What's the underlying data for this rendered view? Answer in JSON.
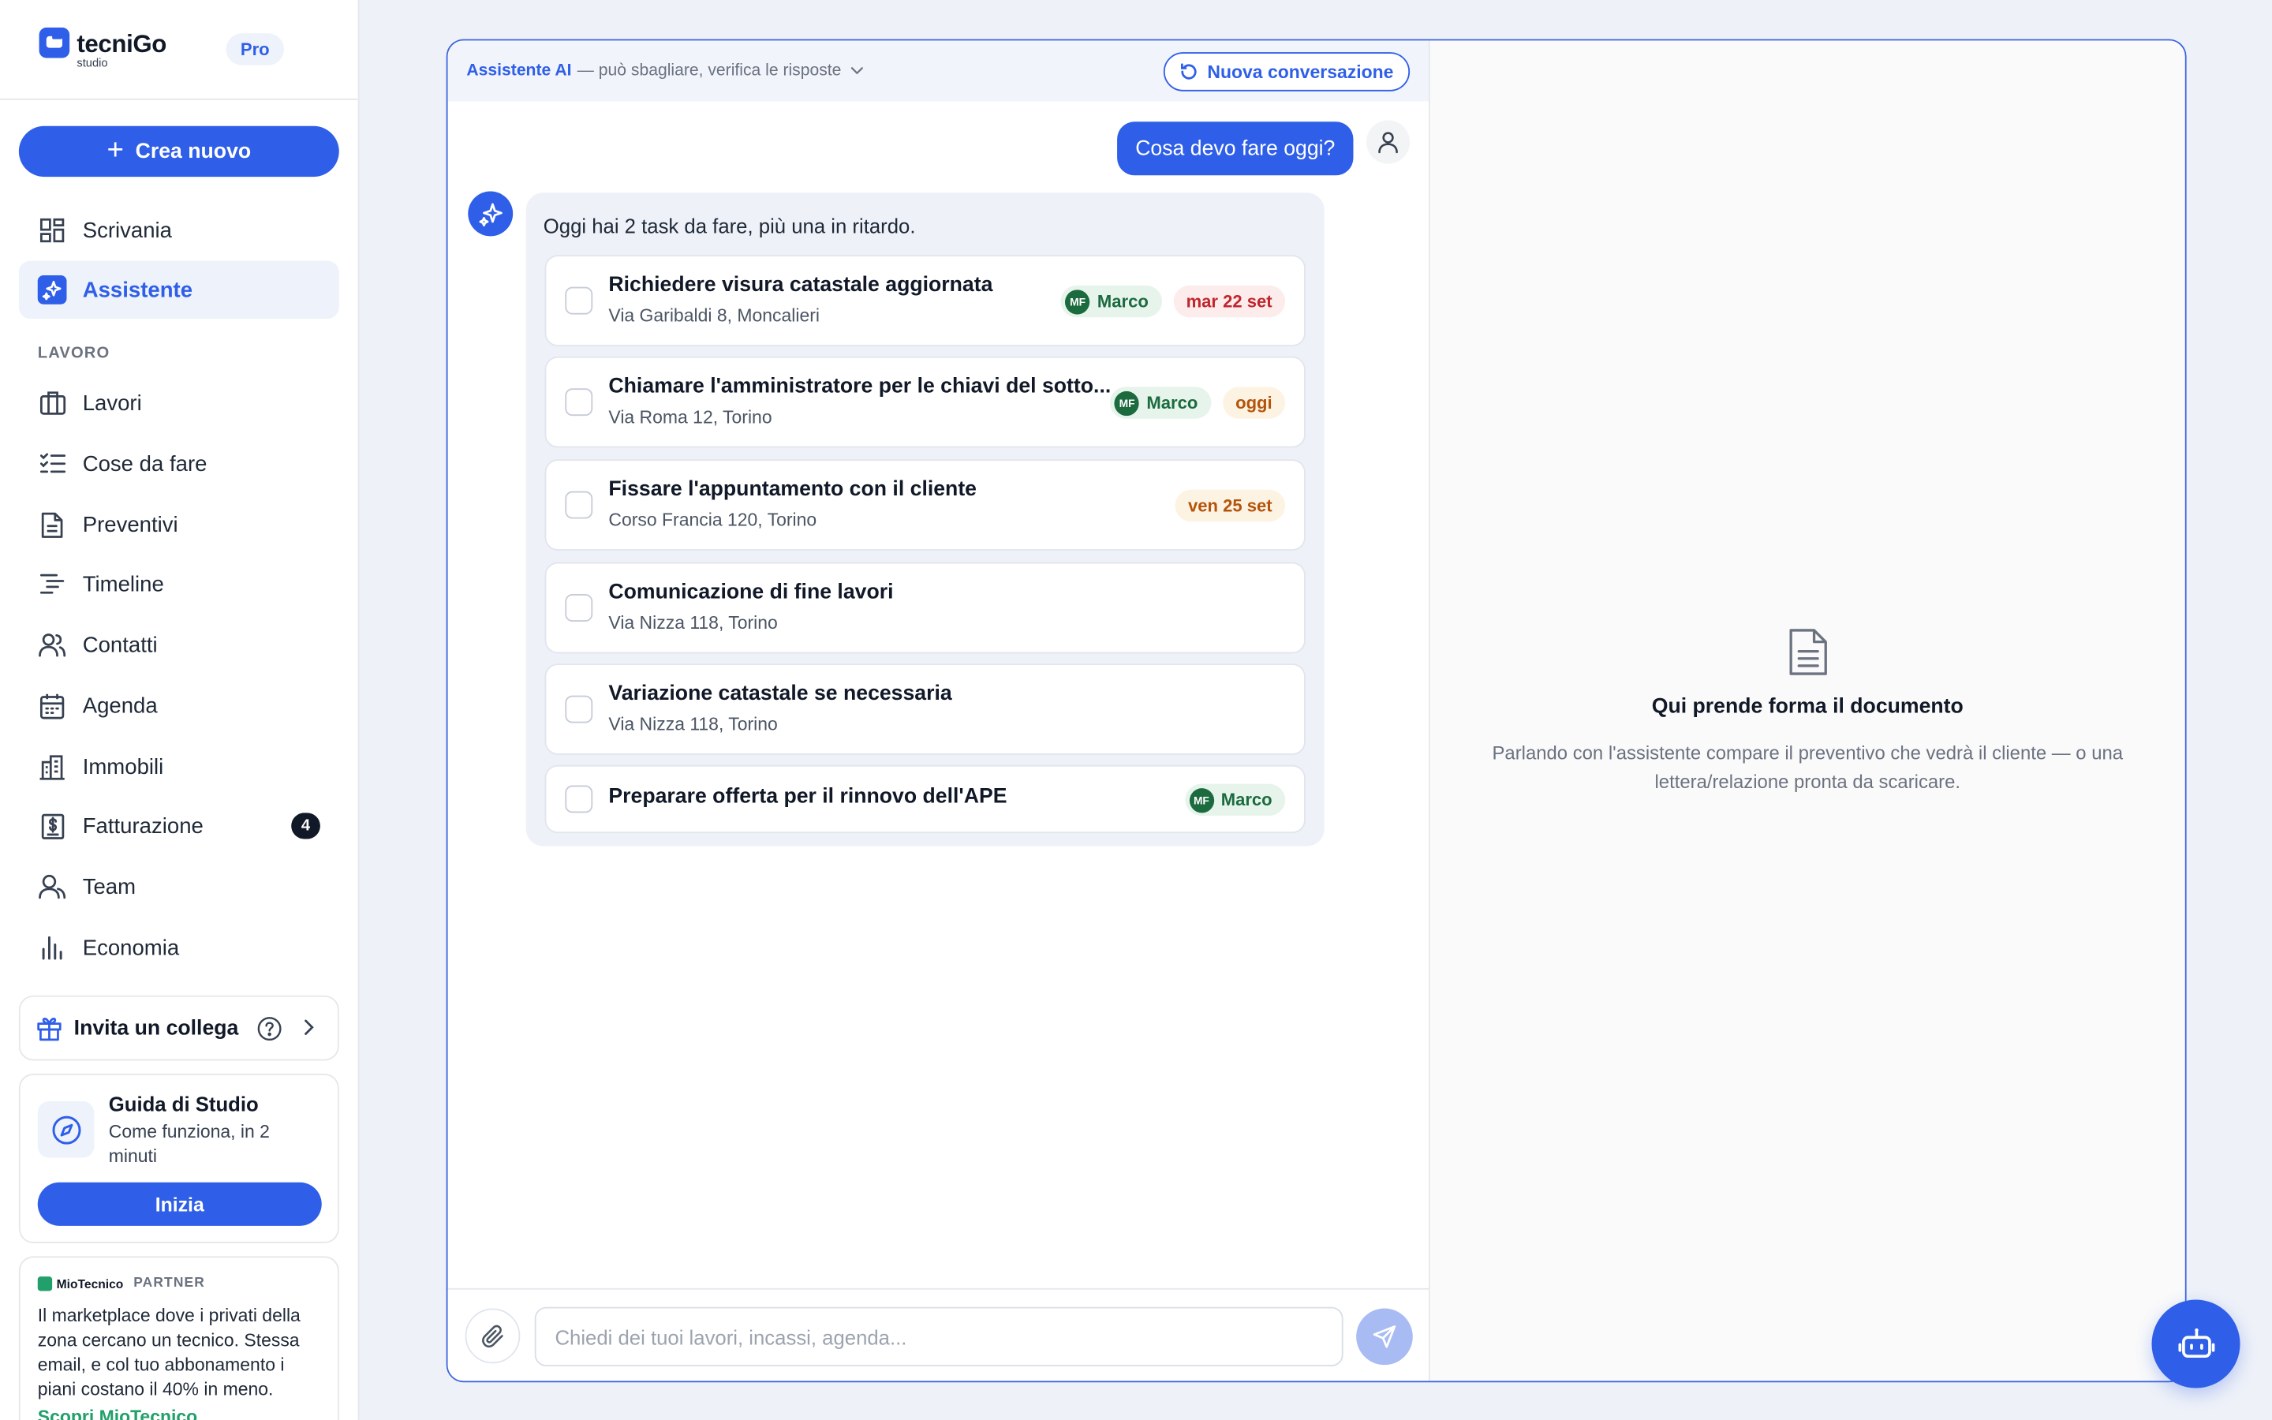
{
  "brand": {
    "name": "tecniGo",
    "sub": "studio",
    "plan": "Pro"
  },
  "sidebar": {
    "create_label": "Crea nuovo",
    "top_items": [
      {
        "label": "Scrivania",
        "icon": "dashboard-icon"
      },
      {
        "label": "Assistente",
        "icon": "sparkles-icon",
        "active": true
      }
    ],
    "section_label": "LAVORO",
    "work_items": [
      {
        "label": "Lavori",
        "icon": "briefcase-icon"
      },
      {
        "label": "Cose da fare",
        "icon": "checklist-icon"
      },
      {
        "label": "Preventivi",
        "icon": "document-icon"
      },
      {
        "label": "Timeline",
        "icon": "timeline-icon"
      },
      {
        "label": "Contatti",
        "icon": "contacts-icon"
      },
      {
        "label": "Agenda",
        "icon": "calendar-icon"
      },
      {
        "label": "Immobili",
        "icon": "building-icon"
      },
      {
        "label": "Fatturazione",
        "icon": "invoice-icon",
        "badge": "4"
      },
      {
        "label": "Team",
        "icon": "team-icon"
      },
      {
        "label": "Economia",
        "icon": "bar-chart-icon"
      }
    ],
    "invite_label": "Invita un collega",
    "guide": {
      "title": "Guida di Studio",
      "subtitle": "Come funziona, in 2 minuti",
      "button": "Inizia"
    },
    "partner": {
      "brand": "MioTecnico",
      "tag": "PARTNER",
      "text": "Il marketplace dove i privati della zona cercano un tecnico. Stessa email, e col tuo abbonamento i piani costano il 40% in meno.",
      "link": "Scopri MioTecnico"
    }
  },
  "chat": {
    "title": "Assistente AI",
    "disclaimer": "— può sbagliare, verifica le risposte",
    "new_conversation": "Nuova conversazione",
    "user_message": "Cosa devo fare oggi?",
    "bot_intro": "Oggi hai 2 task da fare, più una in ritardo.",
    "tasks": [
      {
        "title": "Richiedere visura catastale aggiornata",
        "address": "Via Garibaldi 8, Moncalieri",
        "assignee_initials": "MF",
        "assignee": "Marco",
        "due": "mar 22 set",
        "due_status": "late"
      },
      {
        "title": "Chiamare l'amministratore per le chiavi del sotto...",
        "address": "Via Roma 12, Torino",
        "assignee_initials": "MF",
        "assignee": "Marco",
        "due": "oggi",
        "due_status": "today"
      },
      {
        "title": "Fissare l'appuntamento con il cliente",
        "address": "Corso Francia 120, Torino",
        "due": "ven 25 set",
        "due_status": "today"
      },
      {
        "title": "Comunicazione di fine lavori",
        "address": "Via Nizza 118, Torino"
      },
      {
        "title": "Variazione catastale se necessaria",
        "address": "Via Nizza 118, Torino"
      },
      {
        "title": "Preparare offerta per il rinnovo dell'APE",
        "assignee_initials": "MF",
        "assignee": "Marco"
      }
    ],
    "input_placeholder": "Chiedi dei tuoi lavori, incassi, agenda..."
  },
  "document": {
    "title": "Qui prende forma il documento",
    "subtitle": "Parlando con l'assistente compare il preventivo che vedrà il cliente — o una lettera/relazione pronta da scaricare."
  },
  "colors": {
    "accent": "#2f5fe8",
    "late": "#c0262d",
    "today": "#b4540a",
    "assignee": "#1c6b3f"
  }
}
